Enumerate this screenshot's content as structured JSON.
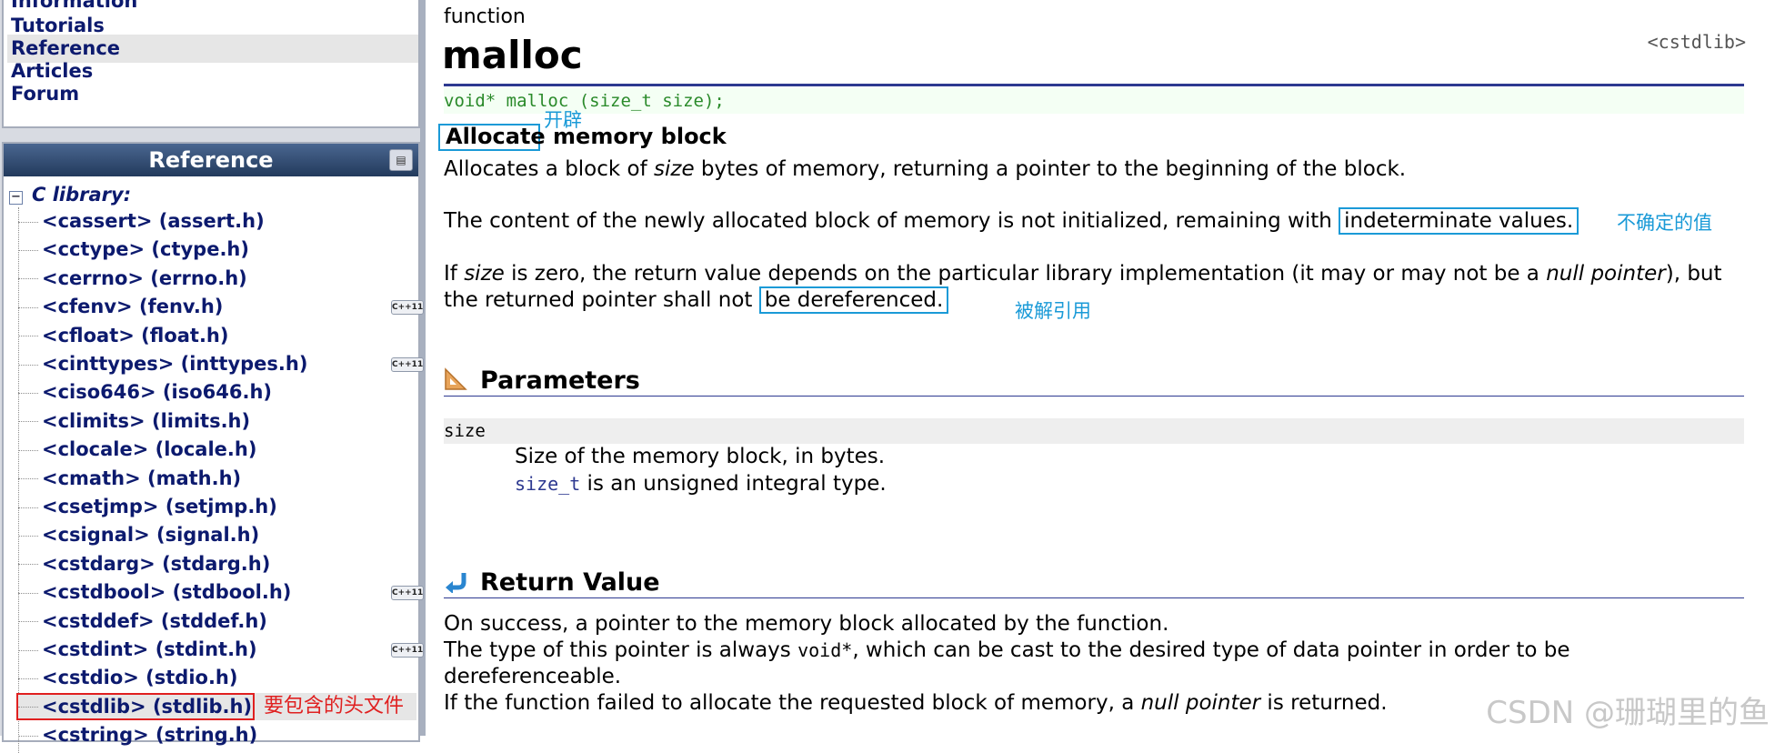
{
  "nav": {
    "items": [
      {
        "label": "Information",
        "active": false
      },
      {
        "label": "Tutorials",
        "active": false
      },
      {
        "label": "Reference",
        "active": true
      },
      {
        "label": "Articles",
        "active": false
      },
      {
        "label": "Forum",
        "active": false
      }
    ]
  },
  "reference_panel": {
    "title": "Reference",
    "clib_label": "C library:",
    "libraries": [
      {
        "label": "<cassert> (assert.h)",
        "cpp11": false
      },
      {
        "label": "<cctype> (ctype.h)",
        "cpp11": false
      },
      {
        "label": "<cerrno> (errno.h)",
        "cpp11": false
      },
      {
        "label": "<cfenv> (fenv.h)",
        "cpp11": true
      },
      {
        "label": "<cfloat> (float.h)",
        "cpp11": false
      },
      {
        "label": "<cinttypes> (inttypes.h)",
        "cpp11": true
      },
      {
        "label": "<ciso646> (iso646.h)",
        "cpp11": false
      },
      {
        "label": "<climits> (limits.h)",
        "cpp11": false
      },
      {
        "label": "<clocale> (locale.h)",
        "cpp11": false
      },
      {
        "label": "<cmath> (math.h)",
        "cpp11": false
      },
      {
        "label": "<csetjmp> (setjmp.h)",
        "cpp11": false
      },
      {
        "label": "<csignal> (signal.h)",
        "cpp11": false
      },
      {
        "label": "<cstdarg> (stdarg.h)",
        "cpp11": false
      },
      {
        "label": "<cstdbool> (stdbool.h)",
        "cpp11": true
      },
      {
        "label": "<cstddef> (stddef.h)",
        "cpp11": false
      },
      {
        "label": "<cstdint> (stdint.h)",
        "cpp11": true
      },
      {
        "label": "<cstdio> (stdio.h)",
        "cpp11": false
      },
      {
        "label": "<cstdlib> (stdlib.h)",
        "cpp11": false,
        "selected": true
      },
      {
        "label": "<cstring> (string.h)",
        "cpp11": false
      }
    ],
    "cpp11_badge": "C++11",
    "stdlib_annotation": "要包含的头文件"
  },
  "article": {
    "kind": "function",
    "name": "malloc",
    "header": "<cstdlib>",
    "prototype": "void* malloc (size_t size);",
    "subtitle_word1": "Allocate",
    "subtitle_rest": " memory block",
    "annotation_allocate": "开辟",
    "p1": {
      "a": "Allocates a block of ",
      "b": "size",
      "c": " bytes of memory, returning a pointer to the beginning of the block."
    },
    "p2": {
      "a": "The content of the newly allocated block of memory is not initialized, remaining with ",
      "b": "indeterminate values."
    },
    "annotation_indeterminate": "不确定的值",
    "p3": {
      "a": "If ",
      "b": "size",
      "c": " is zero, the return value depends on the particular library implementation (it may or may not be a ",
      "d": "null pointer",
      "e": "), but the returned pointer shall not ",
      "f": "be dereferenced."
    },
    "annotation_dereferenced": "被解引用",
    "params": {
      "title": "Parameters",
      "name": "size",
      "desc1": "Size of the memory block, in bytes.",
      "desc2_type": "size_t",
      "desc2_rest": " is an unsigned integral type."
    },
    "return_value": {
      "title": "Return Value",
      "r1": "On success, a pointer to the memory block allocated by the function.",
      "r2a": "The type of this pointer is always ",
      "r2b": "void*",
      "r2c": ", which can be cast to the desired type of data pointer in order to be dereferenceable.",
      "r3a": "If the function failed to allocate the requested block of memory, a ",
      "r3b": "null pointer",
      "r3c": " is returned."
    }
  },
  "watermark": "CSDN @珊瑚里的鱼",
  "colors": {
    "link": "#0c1a6e",
    "annotation_blue": "#1a9ad7",
    "annotation_red": "#e02020",
    "prototype_green": "#2a8a2a",
    "rule": "#2d3990"
  }
}
